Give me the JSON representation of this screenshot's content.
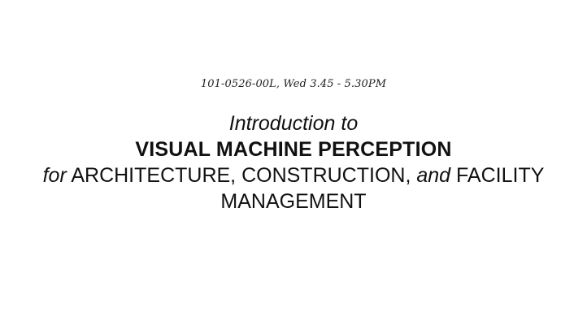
{
  "slide": {
    "course_code": "101-0526-00L, Wed 3.45 - 5.30PM",
    "intro": "Introduction to",
    "main_title": "VISUAL MACHINE PERCEPTION",
    "subtitle": {
      "prefix": "for",
      "part1": " ARCHITECTURE, CONSTRUCTION, ",
      "conjunction": "and",
      "part2": " FACILITY"
    },
    "subtitle_last_line": "MANAGEMENT"
  }
}
